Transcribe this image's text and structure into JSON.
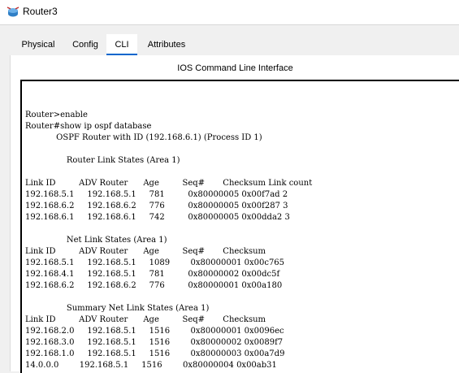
{
  "window": {
    "title": "Router3"
  },
  "tabs": [
    {
      "label": "Physical"
    },
    {
      "label": "Config"
    },
    {
      "label": "CLI"
    },
    {
      "label": "Attributes"
    }
  ],
  "active_tab": "CLI",
  "cli": {
    "header": "IOS Command Line Interface",
    "lines": [
      "Router>enable",
      "Router#show ip ospf database",
      "            OSPF Router with ID (192.168.6.1) (Process ID 1)",
      "",
      "                Router Link States (Area 1)",
      "",
      "Link ID         ADV Router      Age         Seq#       Checksum Link count",
      "192.168.5.1     192.168.5.1     781         0x80000005 0x00f7ad 2",
      "192.168.6.2     192.168.6.2     776         0x80000005 0x00f287 3",
      "192.168.6.1     192.168.6.1     742         0x80000005 0x00dda2 3",
      "",
      "                Net Link States (Area 1)",
      "Link ID         ADV Router      Age         Seq#       Checksum",
      "192.168.5.1     192.168.5.1     1089        0x80000001 0x00c765",
      "192.168.4.1     192.168.5.1     781         0x80000002 0x00dc5f",
      "192.168.6.2     192.168.6.2     776         0x80000001 0x00a180",
      "",
      "                Summary Net Link States (Area 1)",
      "Link ID         ADV Router      Age         Seq#       Checksum",
      "192.168.2.0     192.168.5.1     1516        0x80000001 0x0096ec",
      "192.168.3.0     192.168.5.1     1516        0x80000002 0x0089f7",
      "192.168.1.0     192.168.5.1     1516        0x80000003 0x00a7d9",
      "14.0.0.0        192.168.5.1     1516        0x80000004 0x00ab31"
    ]
  },
  "colors": {
    "active_tab_underline": "#0066cc",
    "panel_bg": "#ffffff",
    "chrome_bg": "#f0f0f0"
  }
}
